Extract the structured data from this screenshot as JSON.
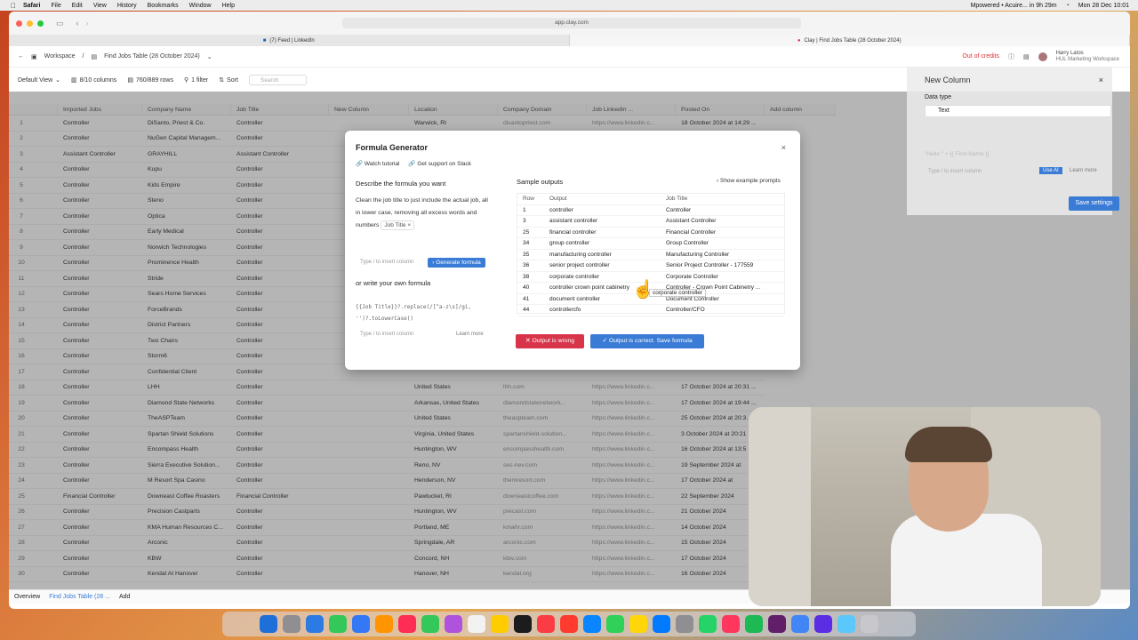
{
  "menubar": {
    "app": "Safari",
    "items": [
      "File",
      "Edit",
      "View",
      "History",
      "Bookmarks",
      "Window",
      "Help"
    ],
    "status": "Mpowered • Acuire... in 9h 29m",
    "clock": "Mon 28 Dec 10:01"
  },
  "browser": {
    "url": "app.clay.com",
    "tabs": [
      {
        "label": "(7) Feed | LinkedIn"
      },
      {
        "label": "Clay | Find Jobs Table (28 October 2024)"
      }
    ]
  },
  "breadcrumb": {
    "workspace": "Workspace",
    "table": "Find Jobs Table (28 October 2024)",
    "credits": "Out of credits",
    "user_name": "Harry Latos",
    "user_sub": "HUL Marketing Workspace"
  },
  "toolbar": {
    "view": "Default View",
    "columns": "8/10 columns",
    "rows": "760/889 rows",
    "filter": "1 filter",
    "sort": "Sort",
    "search": "Search"
  },
  "grid": {
    "headers": [
      "Imported Jobs",
      "Company Name",
      "Job Title",
      "New Column",
      "Location",
      "Company Domain",
      "Job LinkedIn ...",
      "Posted On",
      "Add column"
    ],
    "rows": [
      {
        "n": "1",
        "job": "Controller",
        "co": "DiSanto, Priest & Co.",
        "title": "Controller",
        "loc": "Warwick, RI",
        "dom": "disantopriest.com",
        "li": "https://www.linkedin.c...",
        "posted": "18 October 2024 at 14:29 ..."
      },
      {
        "n": "2",
        "job": "Controller",
        "co": "NuGen Capital Managem...",
        "title": "Controller",
        "loc": "",
        "dom": "",
        "li": "",
        "posted": ""
      },
      {
        "n": "3",
        "job": "Assistant Controller",
        "co": "GRAYHILL",
        "title": "Assistant Controller",
        "loc": "",
        "dom": "",
        "li": "",
        "posted": ""
      },
      {
        "n": "4",
        "job": "Controller",
        "co": "Kupu",
        "title": "Controller",
        "loc": "",
        "dom": "",
        "li": "",
        "posted": ""
      },
      {
        "n": "5",
        "job": "Controller",
        "co": "Kids Empire",
        "title": "Controller",
        "loc": "",
        "dom": "",
        "li": "",
        "posted": ""
      },
      {
        "n": "6",
        "job": "Controller",
        "co": "Steno",
        "title": "Controller",
        "loc": "",
        "dom": "",
        "li": "",
        "posted": ""
      },
      {
        "n": "7",
        "job": "Controller",
        "co": "Optica",
        "title": "Controller",
        "loc": "",
        "dom": "",
        "li": "",
        "posted": ""
      },
      {
        "n": "8",
        "job": "Controller",
        "co": "Early Medical",
        "title": "Controller",
        "loc": "",
        "dom": "",
        "li": "",
        "posted": ""
      },
      {
        "n": "9",
        "job": "Controller",
        "co": "Norwich Technologies",
        "title": "Controller",
        "loc": "",
        "dom": "",
        "li": "",
        "posted": ""
      },
      {
        "n": "10",
        "job": "Controller",
        "co": "Prominence Health",
        "title": "Controller",
        "loc": "",
        "dom": "",
        "li": "",
        "posted": ""
      },
      {
        "n": "11",
        "job": "Controller",
        "co": "Stride",
        "title": "Controller",
        "loc": "",
        "dom": "",
        "li": "",
        "posted": ""
      },
      {
        "n": "12",
        "job": "Controller",
        "co": "Sears Home Services",
        "title": "Controller",
        "loc": "",
        "dom": "",
        "li": "",
        "posted": ""
      },
      {
        "n": "13",
        "job": "Controller",
        "co": "ForceBrands",
        "title": "Controller",
        "loc": "",
        "dom": "",
        "li": "",
        "posted": ""
      },
      {
        "n": "14",
        "job": "Controller",
        "co": "District Partners",
        "title": "Controller",
        "loc": "",
        "dom": "",
        "li": "",
        "posted": ""
      },
      {
        "n": "15",
        "job": "Controller",
        "co": "Two Chairs",
        "title": "Controller",
        "loc": "",
        "dom": "",
        "li": "",
        "posted": ""
      },
      {
        "n": "16",
        "job": "Controller",
        "co": "Storm6",
        "title": "Controller",
        "loc": "",
        "dom": "",
        "li": "",
        "posted": ""
      },
      {
        "n": "17",
        "job": "Controller",
        "co": "Confidential Client",
        "title": "Controller",
        "loc": "",
        "dom": "",
        "li": "",
        "posted": ""
      },
      {
        "n": "18",
        "job": "Controller",
        "co": "LHH",
        "title": "Controller",
        "loc": "United States",
        "dom": "lhh.com",
        "li": "https://www.linkedin.c...",
        "posted": "17 October 2024 at 20:31 ..."
      },
      {
        "n": "19",
        "job": "Controller",
        "co": "Diamond State Networks",
        "title": "Controller",
        "loc": "Arkansas, United States",
        "dom": "diamondstatenetwork...",
        "li": "https://www.linkedin.c...",
        "posted": "17 October 2024 at 19:44 ..."
      },
      {
        "n": "20",
        "job": "Controller",
        "co": "TheASPTeam",
        "title": "Controller",
        "loc": "United States",
        "dom": "theaspteam.com",
        "li": "https://www.linkedin.c...",
        "posted": "25 October 2024 at 20:3..."
      },
      {
        "n": "21",
        "job": "Controller",
        "co": "Spartan Shield Solutions",
        "title": "Controller",
        "loc": "Virginia, United States",
        "dom": "spartanshield-solution...",
        "li": "https://www.linkedin.c...",
        "posted": "3 October 2024 at 20:21"
      },
      {
        "n": "22",
        "job": "Controller",
        "co": "Encompass Health",
        "title": "Controller",
        "loc": "Huntington, WV",
        "dom": "encompasshealth.com",
        "li": "https://www.linkedin.c...",
        "posted": "16 October 2024 at 13:5"
      },
      {
        "n": "23",
        "job": "Controller",
        "co": "Sierra Executive Solution...",
        "title": "Controller",
        "loc": "Reno, NV",
        "dom": "ses-nev.com",
        "li": "https://www.linkedin.c...",
        "posted": "19 September 2024 at"
      },
      {
        "n": "24",
        "job": "Controller",
        "co": "M Resort Spa Casino",
        "title": "Controller",
        "loc": "Henderson, NV",
        "dom": "themresort.com",
        "li": "https://www.linkedin.c...",
        "posted": "17 October 2024 at"
      },
      {
        "n": "25",
        "job": "Financial Controller",
        "co": "Downeast Coffee Roasters",
        "title": "Financial Controller",
        "loc": "Pawtucket, RI",
        "dom": "downeastcoffee.com",
        "li": "https://www.linkedin.c...",
        "posted": "22 September 2024"
      },
      {
        "n": "26",
        "job": "Controller",
        "co": "Precision Castparts",
        "title": "Controller",
        "loc": "Huntington, WV",
        "dom": "precast.com",
        "li": "https://www.linkedin.c...",
        "posted": "21 October 2024"
      },
      {
        "n": "27",
        "job": "Controller",
        "co": "KMA Human Resources C...",
        "title": "Controller",
        "loc": "Portland, ME",
        "dom": "kmahr.com",
        "li": "https://www.linkedin.c...",
        "posted": "14 October 2024"
      },
      {
        "n": "28",
        "job": "Controller",
        "co": "Arconic",
        "title": "Controller",
        "loc": "Springdale, AR",
        "dom": "arconic.com",
        "li": "https://www.linkedin.c...",
        "posted": "15 October 2024"
      },
      {
        "n": "29",
        "job": "Controller",
        "co": "KBW",
        "title": "Controller",
        "loc": "Concord, NH",
        "dom": "kbw.com",
        "li": "https://www.linkedin.c...",
        "posted": "17 October 2024"
      },
      {
        "n": "30",
        "job": "Controller",
        "co": "Kendal At Hanover",
        "title": "Controller",
        "loc": "Hanover, NH",
        "dom": "kendal.org",
        "li": "https://www.linkedin.c...",
        "posted": "16 October 2024"
      }
    ]
  },
  "bottom": {
    "overview": "Overview",
    "table_tab": "Find Jobs Table (28 ...",
    "add": "Add"
  },
  "modal": {
    "title": "Formula Generator",
    "watch": "Watch tutorial",
    "support": "Get support on Slack",
    "describe_label": "Describe the formula you want",
    "prompt": "Clean the job title to just include the actual job, all in lower case, removing all excess words and numbers",
    "chip": "Job Title",
    "insert_hint": "Type / to insert column",
    "generate": "Generate formula",
    "own_label": "or write your own formula",
    "code": "{{Job Title}}?.replace(/[^a-z\\s]/gi, '')?.toLowerCase()",
    "learn_more": "Learn more",
    "sample_label": "Sample outputs",
    "show_prompts": "Show example prompts",
    "table_headers": [
      "Row",
      "Output",
      "Job Title"
    ],
    "samples": [
      {
        "row": "1",
        "out": "controller",
        "title": "Controller"
      },
      {
        "row": "3",
        "out": "assistant controller",
        "title": "Assistant Controller"
      },
      {
        "row": "25",
        "out": "financial controller",
        "title": "Financial Controller"
      },
      {
        "row": "34",
        "out": "group controller",
        "title": "Group Controller"
      },
      {
        "row": "35",
        "out": "manufacturing controller",
        "title": "Manufacturing Controller"
      },
      {
        "row": "36",
        "out": "senior project controller",
        "title": "Senior Project Controller - 177559"
      },
      {
        "row": "38",
        "out": "corporate controller",
        "title": "Corporate Controller"
      },
      {
        "row": "40",
        "out": "controller crown point cabinetry",
        "title": "Controller - Crown Point Cabinetry ..."
      },
      {
        "row": "41",
        "out": "document controller",
        "title": "Document Controller"
      },
      {
        "row": "44",
        "out": "controllercfo",
        "title": "Controller/CFO"
      }
    ],
    "tooltip": "corporate controller",
    "wrong": "Output is wrong",
    "correct": "Output is correct. Save formula"
  },
  "panel": {
    "title": "New Column",
    "data_type_label": "Data type",
    "data_type": "Text",
    "formula_placeholder": "\"Hello \" + {{ First Name }}",
    "insert_hint": "Type / to insert column",
    "use_ai": "Use AI",
    "learn_more": "Learn more",
    "save": "Save settings"
  }
}
